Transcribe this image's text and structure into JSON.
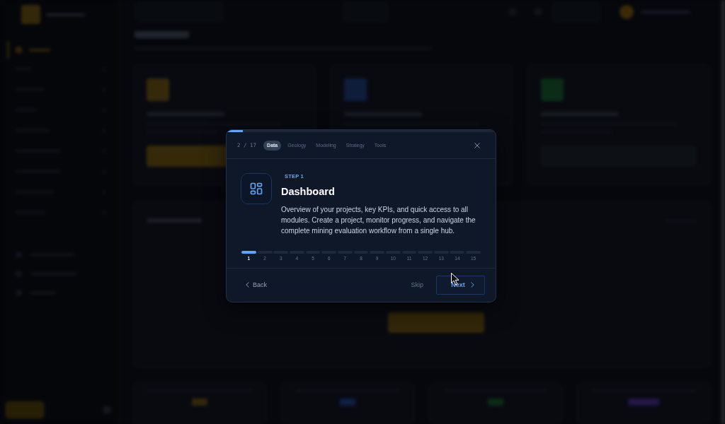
{
  "dialog": {
    "progress": {
      "level": 0.06
    },
    "counter": "2 / 17",
    "tabs": [
      {
        "label": "Data",
        "selected": true
      },
      {
        "label": "Geology",
        "selected": false
      },
      {
        "label": "Modeling",
        "selected": false
      },
      {
        "label": "Strategy",
        "selected": false
      },
      {
        "label": "Tools",
        "selected": false
      }
    ]
  },
  "step": {
    "badge": "STEP 1",
    "title": "Dashboard",
    "description": "Overview of your projects, key KPIs, and quick access to all modules. Create a project, monitor progress, and navigate the complete mining evaluation workflow from a single hub."
  },
  "step_track": [
    {
      "label": "1",
      "selected": true
    },
    {
      "label": "2",
      "selected": false
    },
    {
      "label": "3",
      "selected": false
    },
    {
      "label": "4",
      "selected": false
    },
    {
      "label": "5",
      "selected": false
    },
    {
      "label": "6",
      "selected": false
    },
    {
      "label": "7",
      "selected": false
    },
    {
      "label": "8",
      "selected": false
    },
    {
      "label": "9",
      "selected": false
    },
    {
      "label": "10",
      "selected": false
    },
    {
      "label": "11",
      "selected": false
    },
    {
      "label": "12",
      "selected": false
    },
    {
      "label": "13",
      "selected": false
    },
    {
      "label": "14",
      "selected": false
    },
    {
      "label": "15",
      "selected": false
    }
  ],
  "footer": {
    "back": "Back",
    "skip": "Skip",
    "next": "Next"
  }
}
